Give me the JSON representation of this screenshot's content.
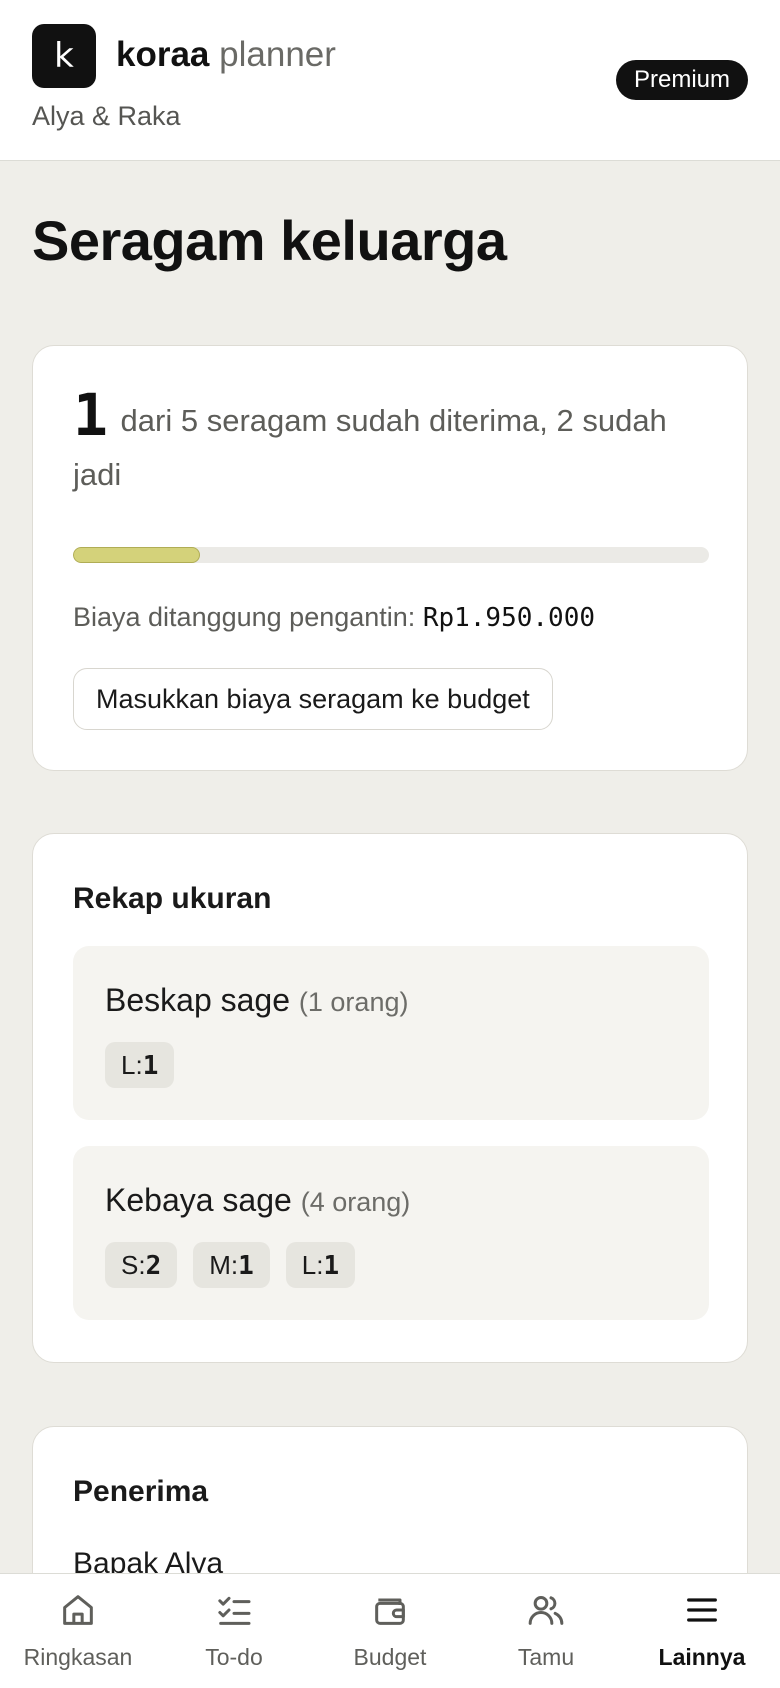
{
  "header": {
    "logo_letter": "k",
    "brand_name": "koraa",
    "brand_sub": "planner",
    "couple": "Alya & Raka",
    "badge": "Premium"
  },
  "page": {
    "title": "Seragam keluarga"
  },
  "summary": {
    "received": "1",
    "text": "dari 5 seragam sudah diterima, 2 sudah jadi",
    "progress_fraction": 0.2,
    "cost_label": "Biaya ditanggung pengantin:",
    "cost_value": "Rp1.950.000",
    "button_label": "Masukkan biaya seragam ke budget"
  },
  "size_recap": {
    "title": "Rekap ukuran",
    "groups": [
      {
        "name": "Beskap sage",
        "count": "(1 orang)",
        "sizes": [
          {
            "label": "L:",
            "value": "1"
          }
        ]
      },
      {
        "name": "Kebaya sage",
        "count": "(4 orang)",
        "sizes": [
          {
            "label": "S:",
            "value": "2"
          },
          {
            "label": "M:",
            "value": "1"
          },
          {
            "label": "L:",
            "value": "1"
          }
        ]
      }
    ]
  },
  "recipients": {
    "title": "Penerima",
    "first": "Bapak Alya"
  },
  "nav": {
    "items": [
      {
        "label": "Ringkasan",
        "icon": "home-icon"
      },
      {
        "label": "To-do",
        "icon": "checklist-icon"
      },
      {
        "label": "Budget",
        "icon": "wallet-icon"
      },
      {
        "label": "Tamu",
        "icon": "users-icon"
      },
      {
        "label": "Lainnya",
        "icon": "menu-icon"
      }
    ],
    "active": "Lainnya"
  },
  "colors": {
    "background": "#efeee9",
    "progress": "#d4d27a",
    "badge": "#111111"
  }
}
